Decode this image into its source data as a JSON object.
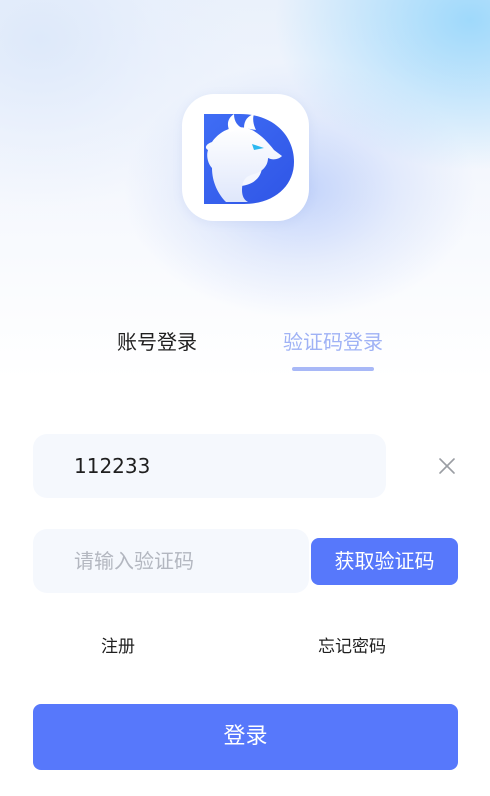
{
  "tabs": {
    "account_label": "账号登录",
    "code_label": "验证码登录",
    "active": "code"
  },
  "phone": {
    "value": "112233"
  },
  "code": {
    "placeholder": "请输入验证码",
    "value": ""
  },
  "buttons": {
    "get_code": "获取验证码",
    "login": "登录"
  },
  "links": {
    "register": "注册",
    "forgot_password": "忘记密码"
  },
  "icons": {
    "logo": "dragon-d-logo-icon",
    "clear": "close-icon"
  },
  "colors": {
    "accent": "#5778fb",
    "active_tab": "#9fb2f5",
    "input_bg": "#f5f8fd"
  }
}
